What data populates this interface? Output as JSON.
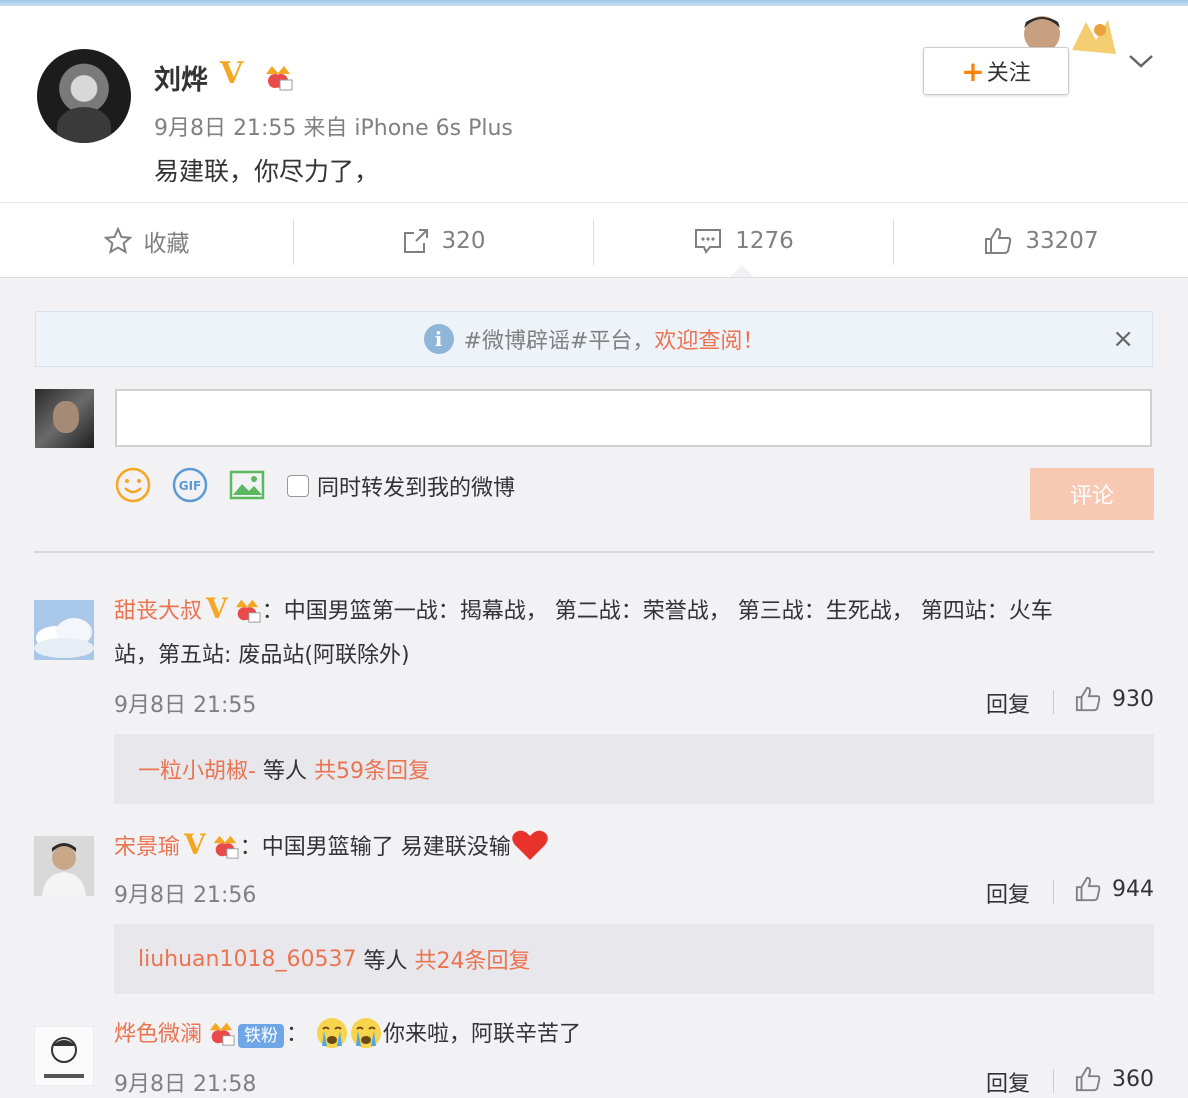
{
  "post": {
    "author": "刘烨",
    "time_source": "9月8日 21:55 来自 iPhone 6s Plus",
    "text": "易建联，你尽力了，",
    "follow_label": "关注"
  },
  "actions": {
    "favorite_label": "收藏",
    "forward_count": "320",
    "comment_count": "1276",
    "like_count": "33207"
  },
  "notice": {
    "prefix": "#微博辟谣#平台，",
    "highlight": "欢迎查阅！",
    "close": "×"
  },
  "composer": {
    "input_value": "",
    "sync_label": "同时转发到我的微博",
    "submit_label": "评论"
  },
  "comments": [
    {
      "user": "甜丧大叔",
      "text_line1": "：中国男篮第一战：揭幕战， 第二战：荣誉战， 第三战：生死战， 第四站：火车",
      "text_line2": "站，第五站: 废品站(阿联除外)",
      "time": "9月8日 21:55",
      "reply_label": "回复",
      "likes": "930",
      "sub_user": "一粒小胡椒-",
      "sub_mid": " 等人 ",
      "sub_count": "共59条回复"
    },
    {
      "user": "宋景瑜",
      "text_line1": "：中国男篮输了 易建联没输",
      "time": "9月8日 21:56",
      "reply_label": "回复",
      "likes": "944",
      "sub_user": "liuhuan1018_60537",
      "sub_mid": " 等人 ",
      "sub_count": "共24条回复"
    },
    {
      "user": "烨色微澜",
      "badge": "铁粉",
      "text_line1": "你来啦，阿联辛苦了",
      "time": "9月8日 21:58",
      "reply_label": "回复",
      "likes": "360"
    }
  ],
  "colors": {
    "accent_orange": "#eb7350",
    "follow_plus": "#ff8200",
    "verified_gold": "#f5a623",
    "submit_disabled": "#f7c8b2"
  },
  "icons": [
    "star-icon",
    "forward-icon",
    "comment-icon",
    "thumbs-up-icon",
    "info-icon",
    "close-icon",
    "smile-icon",
    "gif-icon",
    "image-icon",
    "chevron-down-icon",
    "crown-icon",
    "heart-icon",
    "crying-face-icon"
  ]
}
